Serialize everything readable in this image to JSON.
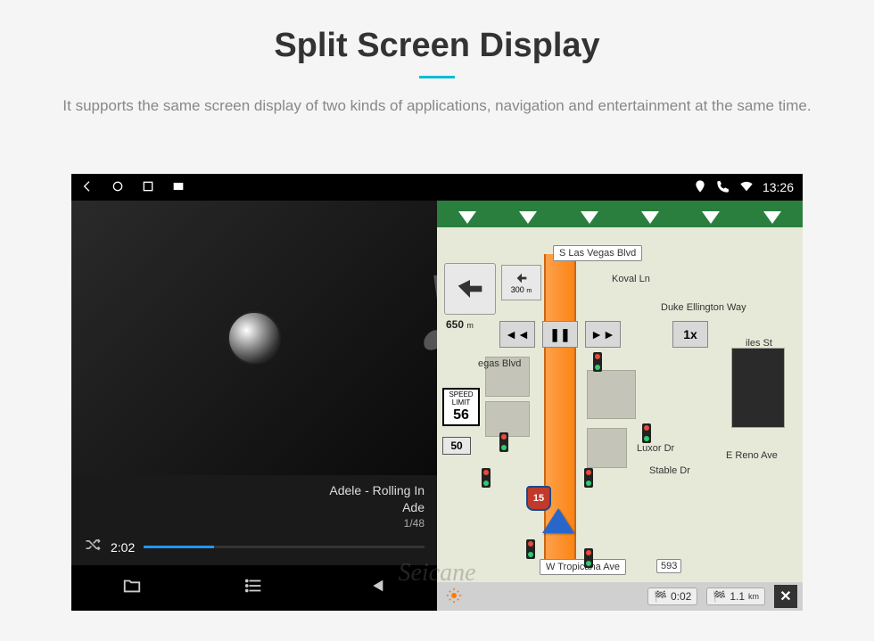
{
  "header": {
    "title": "Split Screen Display",
    "description": "It supports the same screen display of two kinds of applications, navigation and entertainment at the same time."
  },
  "statusbar": {
    "time": "13:26"
  },
  "music": {
    "track_title": "Adele - Rolling In",
    "artist": "Ade",
    "count": "1/48",
    "elapsed": "2:02"
  },
  "nav": {
    "toproad": "S Las Vegas Blvd",
    "next_turn_dist_value": "300",
    "next_turn_dist_unit": "m",
    "distance": "650",
    "distance_unit": "m",
    "controls": {
      "prev": "◄◄",
      "pause": "❚❚",
      "next": "►►",
      "speed": "1x"
    },
    "labels": {
      "vegas_blvd": "egas Blvd",
      "koval_ln": "Koval Ln",
      "duke": "Duke Ellington Way",
      "luxor": "Luxor Dr",
      "reno": "E Reno Ave",
      "stable": "Stable Dr",
      "giles": "iles St",
      "bottom": "W Tropicana Ave",
      "bottom_badge": "593"
    },
    "speed_limit_label": "SPEED LIMIT",
    "speed_limit": "56",
    "route": "50",
    "interstate": "15",
    "eta_time": "0:02",
    "eta_dist": "1.1",
    "eta_dist_unit": "km"
  },
  "watermark": "Seicane"
}
